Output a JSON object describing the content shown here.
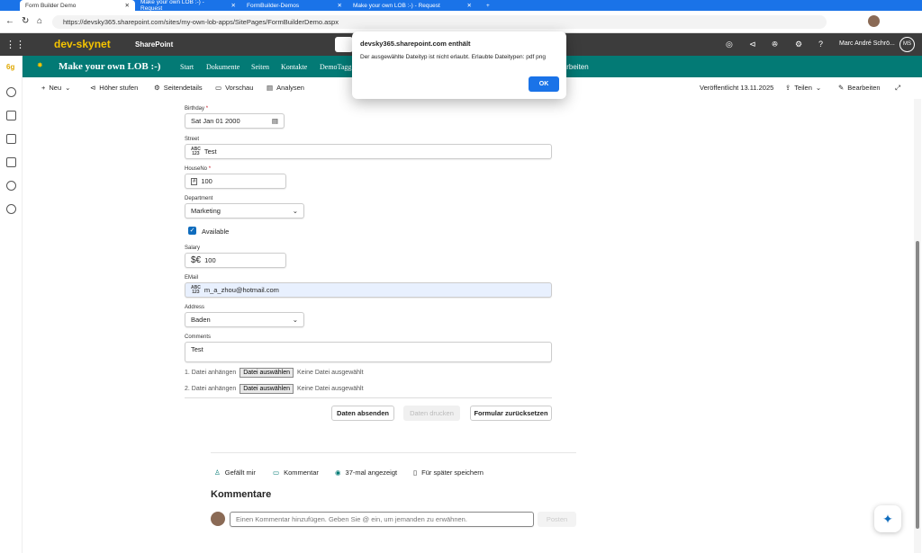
{
  "browser": {
    "tabs": [
      "Form Builder Demo",
      "Make your own LOB :-) - Request",
      "FormBuilder-Demos",
      "Make your own LOB :-) - Request"
    ],
    "url": "https://devsky365.sharepoint.com/sites/my-own-lob-apps/SitePages/FormBuilderDemo.aspx"
  },
  "suite": {
    "logo": "dev-skynet",
    "app": "SharePoint",
    "user": "Marc André Schrö...",
    "initials": "MS"
  },
  "hub": {
    "title": "Make your own LOB :-)",
    "nav": [
      "Start",
      "Dokumente",
      "Seiten",
      "Kontakte",
      "DemoTagg"
    ],
    "edit": "Bearbeiten"
  },
  "commandbar": {
    "new": "Neu",
    "promote": "Höher stufen",
    "details": "Seitendetails",
    "preview": "Vorschau",
    "analytics": "Analysen",
    "published": "Veröffentlicht 13.11.2025",
    "share": "Teilen",
    "edit": "Bearbeiten"
  },
  "dialog": {
    "title": "devsky365.sharepoint.com enthält",
    "message": "Der ausgewählte Dateityp ist nicht erlaubt. Erlaubte Dateitypen: pdf png",
    "ok": "OK"
  },
  "form": {
    "birthday": {
      "label": "Birthday",
      "value": "Sat Jan 01 2000"
    },
    "street": {
      "label": "Street",
      "value": "Test"
    },
    "houseno": {
      "label": "HouseNo",
      "value": "100"
    },
    "department": {
      "label": "Department",
      "value": "Marketing"
    },
    "available": {
      "label": "Available",
      "checked": true
    },
    "salary": {
      "label": "Salary",
      "value": "100"
    },
    "email": {
      "label": "EMail",
      "value": "m_a_zhou@hotmail.com"
    },
    "address": {
      "label": "Address",
      "value": "Baden"
    },
    "comments": {
      "label": "Comments",
      "value": "Test"
    },
    "file1": {
      "label": "1. Datei anhängen",
      "button": "Datei auswählen",
      "status": "Keine Datei ausgewählt"
    },
    "file2": {
      "label": "2. Datei anhängen",
      "button": "Datei auswählen",
      "status": "Keine Datei ausgewählt"
    },
    "submit": "Daten absenden",
    "print": "Daten drucken",
    "reset": "Formular zurücksetzen"
  },
  "social": {
    "like": "Gefällt mir",
    "comment": "Kommentar",
    "views": "37-mal angezeigt",
    "save": "Für später speichern"
  },
  "comments": {
    "heading": "Kommentare",
    "placeholder": "Einen Kommentar hinzufügen. Geben Sie @ ein, um jemanden zu erwähnen.",
    "post": "Posten"
  }
}
